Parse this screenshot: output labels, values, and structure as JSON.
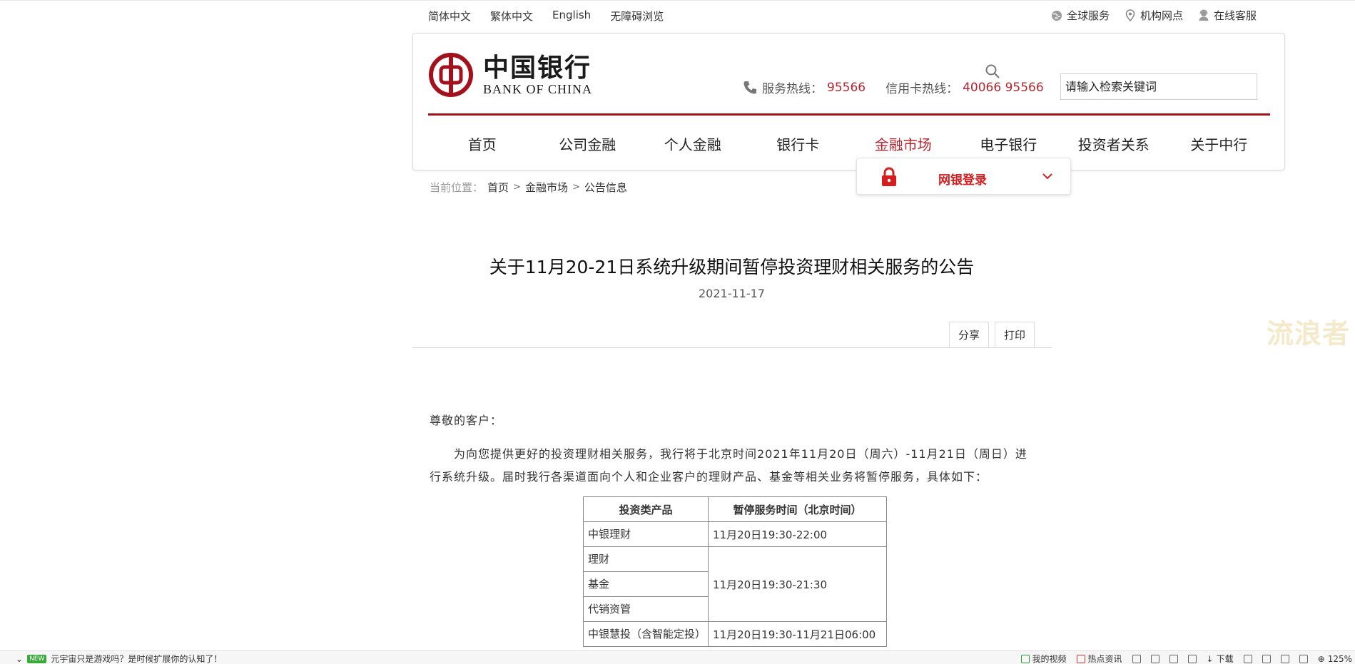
{
  "language_bar": [
    "简体中文",
    "繁体中文",
    "English",
    "无障碍浏览"
  ],
  "util_bar": [
    {
      "label": "全球服务",
      "icon": "globe-icon"
    },
    {
      "label": "机构网点",
      "icon": "location-pin-icon"
    },
    {
      "label": "在线客服",
      "icon": "customer-service-icon"
    }
  ],
  "logo": {
    "cn": "中国银行",
    "en": "BANK OF CHINA"
  },
  "hotlines": {
    "service_label": "服务热线：",
    "service_number": "95566",
    "credit_label": "信用卡热线：",
    "credit_number": "40066 95566"
  },
  "search": {
    "placeholder": "请输入检索关键词"
  },
  "main_nav": [
    "首页",
    "公司金融",
    "个人金融",
    "银行卡",
    "金融市场",
    "电子银行",
    "投资者关系",
    "关于中行"
  ],
  "active_nav": "金融市场",
  "netbank": {
    "label": "网银登录"
  },
  "breadcrumb": {
    "prefix": "当前位置：",
    "items": [
      "首页",
      "金融市场",
      "公告信息"
    ]
  },
  "article": {
    "title": "关于11月20-21日系统升级期间暂停投资理财相关服务的公告",
    "date": "2021-11-17",
    "share": "分享",
    "print": "打印",
    "salutation": "尊敬的客户：",
    "paragraph": "为向您提供更好的投资理财相关服务，我行将于北京时间2021年11月20日（周六）-11月21日（周日）进行系统升级。届时我行各渠道面向个人和企业客户的理财产品、基金等相关业务将暂停服务，具体如下："
  },
  "table": {
    "headers": [
      "投资类产品",
      "暂停服务时间（北京时间）"
    ],
    "rows": [
      {
        "product": "中银理财",
        "time": "11月20日19:30-22:00"
      },
      {
        "product": "理财",
        "time": "11月20日19:30-21:30"
      },
      {
        "product": "基金",
        "time": ""
      },
      {
        "product": "代销资管",
        "time": ""
      },
      {
        "product": "中银慧投（含智能定投）",
        "time": "11月20日19:30-11月21日06:00"
      }
    ]
  },
  "watermark": "流浪者",
  "statusbar": {
    "badge": "NEW",
    "news": "元宇宙只是游戏吗？是时候扩展你的认知了！",
    "my_video": "我的视频",
    "hot_news": "热点资讯",
    "download": "下载",
    "zoom": "125%"
  },
  "colors": {
    "brand_red": "#a3121c",
    "accent_red": "#b5262f",
    "login_red": "#d3201f"
  }
}
